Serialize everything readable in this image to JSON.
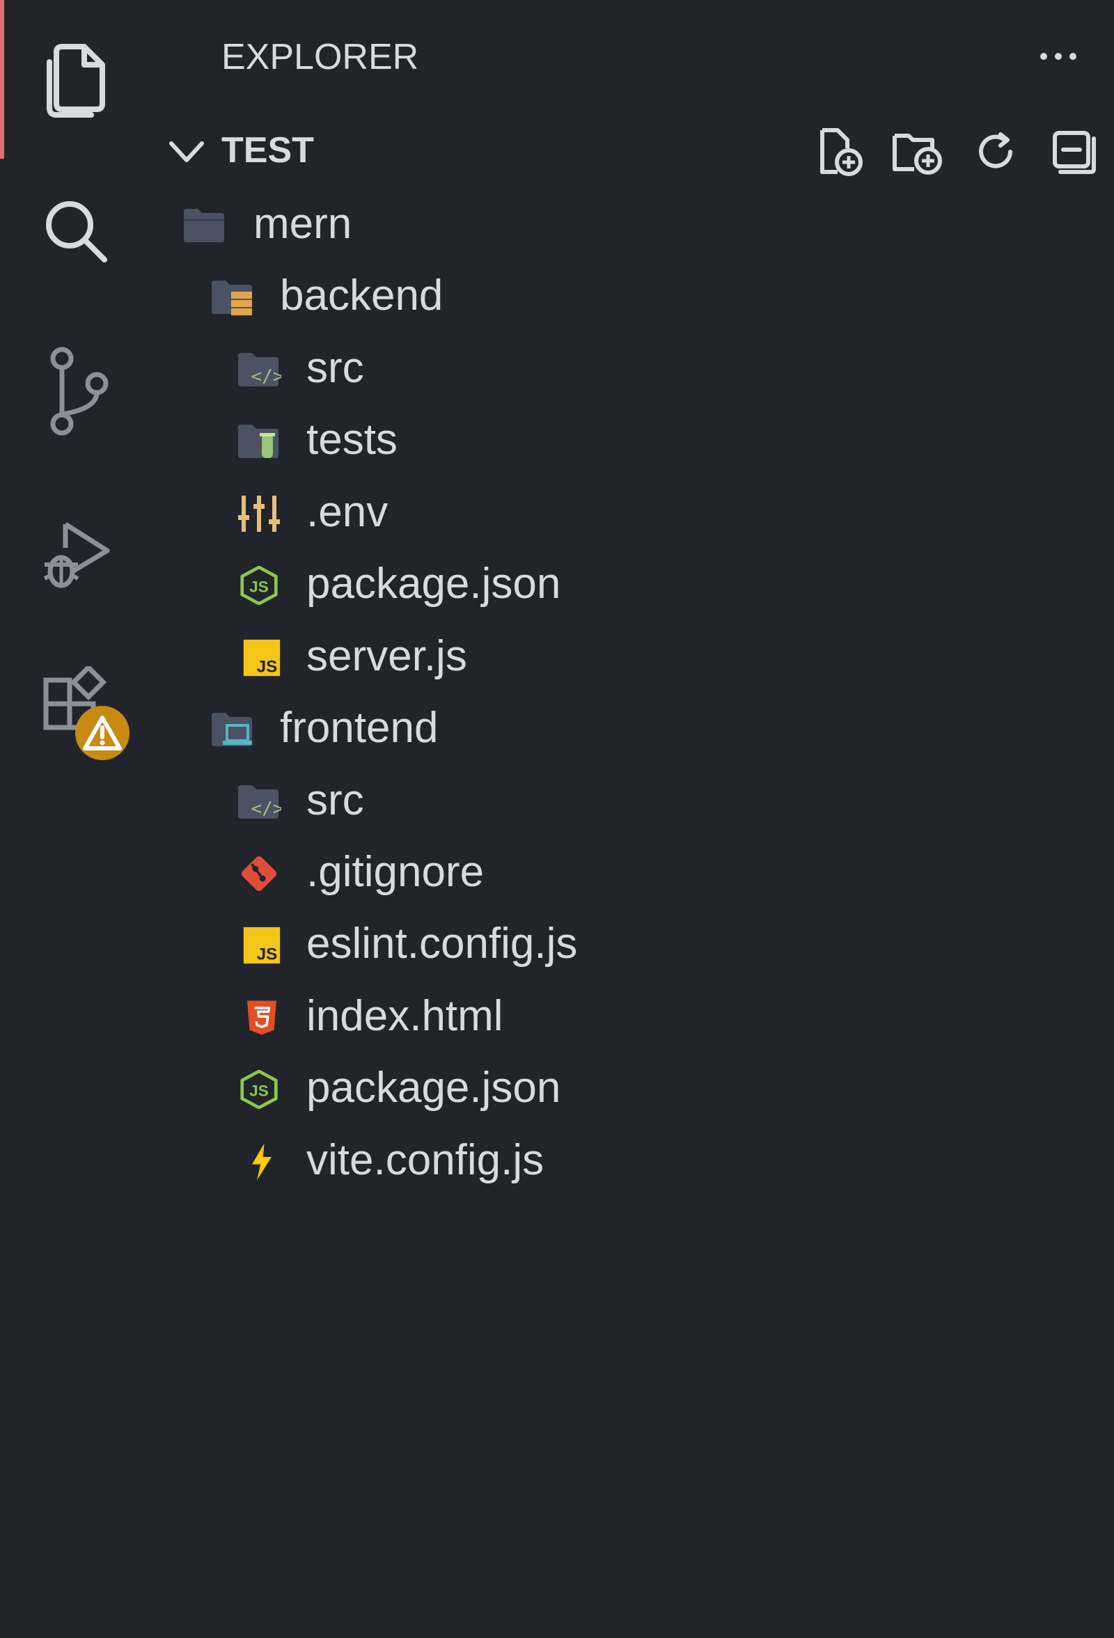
{
  "activity_bar": {
    "items": [
      {
        "name": "explorer",
        "icon": "files-icon",
        "active": true
      },
      {
        "name": "search",
        "icon": "search-icon",
        "active": false
      },
      {
        "name": "source-control",
        "icon": "source-control-icon",
        "active": false
      },
      {
        "name": "run-debug",
        "icon": "run-debug-icon",
        "active": false
      },
      {
        "name": "extensions",
        "icon": "extensions-icon",
        "active": false,
        "badge_icon": "warning-icon"
      }
    ]
  },
  "sidebar": {
    "title": "EXPLORER",
    "more_icon": "ellipsis-icon",
    "section": {
      "title": "TEST",
      "expanded": true,
      "actions": [
        {
          "name": "new-file",
          "icon": "new-file-icon"
        },
        {
          "name": "new-folder",
          "icon": "new-folder-icon"
        },
        {
          "name": "refresh",
          "icon": "refresh-icon"
        },
        {
          "name": "collapse-all",
          "icon": "collapse-all-icon"
        }
      ]
    },
    "tree": [
      {
        "label": "mern",
        "icon": "folder-icon",
        "depth": 0
      },
      {
        "label": "backend",
        "icon": "folder-server-icon",
        "depth": 1
      },
      {
        "label": "src",
        "icon": "folder-src-icon",
        "depth": 2
      },
      {
        "label": "tests",
        "icon": "folder-test-icon",
        "depth": 2
      },
      {
        "label": ".env",
        "icon": "env-settings-icon",
        "depth": 2
      },
      {
        "label": "package.json",
        "icon": "nodejs-icon",
        "depth": 2
      },
      {
        "label": "server.js",
        "icon": "javascript-icon",
        "depth": 2
      },
      {
        "label": "frontend",
        "icon": "folder-client-icon",
        "depth": 1
      },
      {
        "label": "src",
        "icon": "folder-src-icon",
        "depth": 2
      },
      {
        "label": ".gitignore",
        "icon": "git-icon",
        "depth": 2
      },
      {
        "label": "eslint.config.js",
        "icon": "javascript-icon",
        "depth": 2
      },
      {
        "label": "index.html",
        "icon": "html5-icon",
        "depth": 2
      },
      {
        "label": "package.json",
        "icon": "nodejs-icon",
        "depth": 2
      },
      {
        "label": "vite.config.js",
        "icon": "vite-icon",
        "depth": 2
      }
    ]
  },
  "colors": {
    "background": "#21252b",
    "text": "#d7dae0",
    "active_indicator": "#e06c75",
    "badge": "#c88a12",
    "js": "#f5c518",
    "node": "#8cc84b",
    "html": "#e44d26",
    "git": "#e04e39",
    "folder": "#4b5263",
    "env": "#e5c07b"
  }
}
